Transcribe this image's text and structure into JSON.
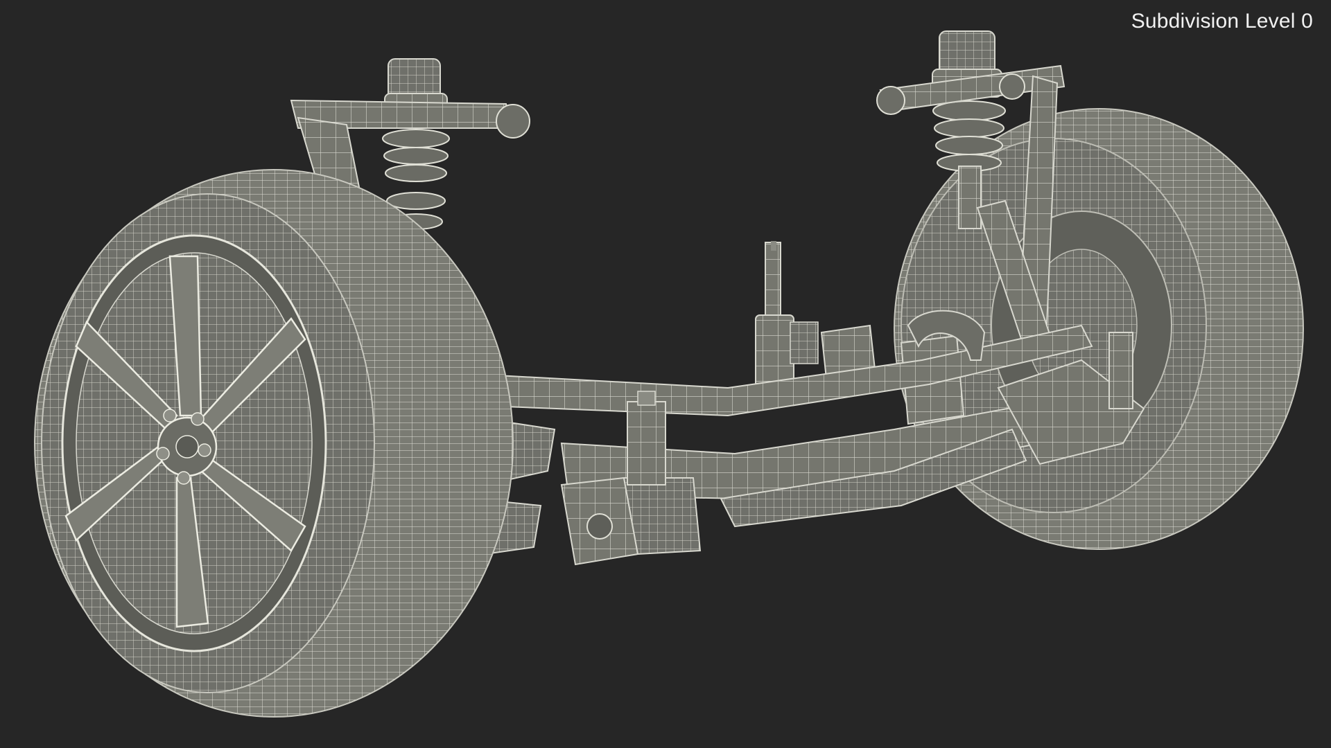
{
  "viewport": {
    "overlay_label": "Subdivision Level 0",
    "background_color": "#262626"
  },
  "model": {
    "render_style": "wireframe-on-shaded",
    "surface_color": "#75766e",
    "wire_color": "#e8e8e0",
    "shadow_color": "#4a4b45"
  }
}
